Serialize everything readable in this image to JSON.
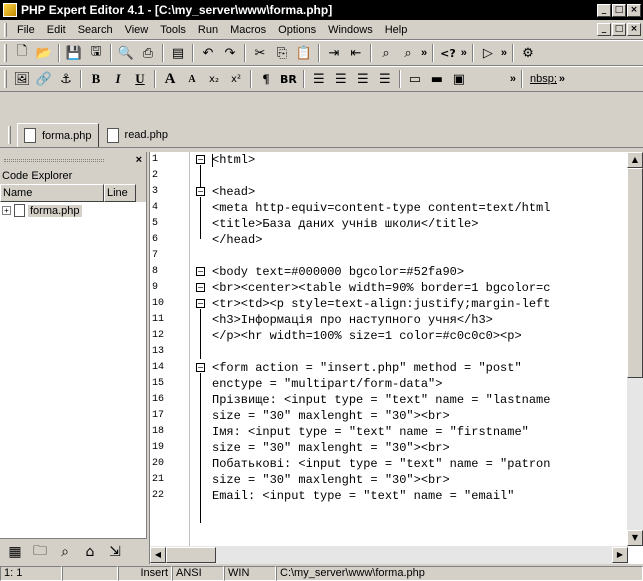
{
  "window": {
    "title": "PHP Expert Editor 4.1 - [C:\\my_server\\www\\forma.php]",
    "min": "_",
    "max": "□",
    "close": "×"
  },
  "menu": [
    "File",
    "Edit",
    "Search",
    "View",
    "Tools",
    "Run",
    "Macros",
    "Options",
    "Windows",
    "Help"
  ],
  "toolbar2": {
    "php_tag": "<?",
    "nbsp": "nbsp;"
  },
  "toolbar3": {
    "bold": "B",
    "italic": "I",
    "underline": "U",
    "font_big": "A",
    "font_small": "A",
    "sub": "x₂",
    "sup": "x²",
    "para": "¶",
    "br": "BR",
    "nbsp": "nbsp;"
  },
  "tabs": [
    {
      "label": "forma.php",
      "active": true
    },
    {
      "label": "read.php",
      "active": false
    }
  ],
  "explorer": {
    "title": "Code Explorer",
    "close": "×",
    "columns": [
      "Name",
      "Line"
    ],
    "tree": [
      {
        "label": "forma.php"
      }
    ]
  },
  "editor": {
    "line_numbers": [
      "1",
      "2",
      "3",
      "4",
      "5",
      "6",
      "7",
      "8",
      "9",
      "10",
      "11",
      "12",
      "13",
      "14",
      "15",
      "16",
      "17",
      "18",
      "19",
      "20",
      "21",
      "22"
    ],
    "lines": [
      "<html>",
      "",
      "<head>",
      "<meta http-equiv=content-type content=text/html",
      "<title>База даних учнів школи</title>",
      "</head>",
      "",
      "<body text=#000000 bgcolor=#52fa90>",
      "<br><center><table width=90% border=1 bgcolor=c",
      "<tr><td><p style=text-align:justify;margin-left",
      "<h3>Інформація про наступного учня</h3>",
      "</p><hr width=100% size=1 color=#c0c0c0><p>",
      "",
      "<form action = \"insert.php\" method = \"post\"",
      "enctype = \"multipart/form-data\">",
      "Прізвище: <input type = \"text\" name = \"lastname",
      "size = \"30\" maxlenght = \"30\"><br>",
      "Імя: <input type = \"text\" name = \"firstname\"",
      "size = \"30\" maxlenght = \"30\"><br>",
      "Побатькові: <input type = \"text\" name = \"patron",
      "size = \"30\" maxlenght = \"30\"><br>",
      "Email: <input type = \"text\" name = \"email\""
    ]
  },
  "status": {
    "position": "1: 1",
    "mode": "Insert",
    "encoding": "ANSI",
    "format": "WIN",
    "path": "C:\\my_server\\www\\forma.php"
  }
}
